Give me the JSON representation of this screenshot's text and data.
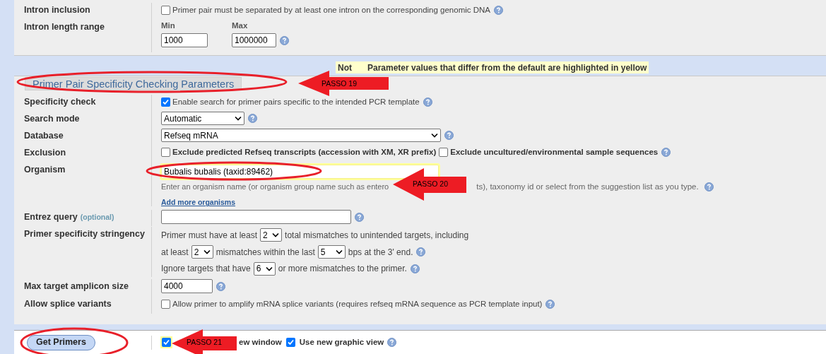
{
  "intron_section": {
    "rows": [
      {
        "kind": "checkbox",
        "label": "Intron inclusion",
        "checked": false,
        "text": "Primer pair must be separated by at least one intron on the corresponding genomic DNA",
        "help": true
      },
      {
        "kind": "range",
        "label": "Intron length range",
        "min_label": "Min",
        "min_value": "1000",
        "max_label": "Max",
        "max_value": "1000000",
        "help": true
      }
    ]
  },
  "note": {
    "visible_start": "Not",
    "visible_end": "Parameter values that differ from the default are highlighted in yellow"
  },
  "specificity_section": {
    "title": "Primer Pair Specificity Checking Parameters",
    "rows": [
      {
        "kind": "checkbox",
        "label": "Specificity check",
        "checked": true,
        "text": "Enable search for primer pairs specific to the intended PCR template",
        "help": true
      },
      {
        "kind": "short_select",
        "label": "Search mode",
        "value": "Automatic",
        "help": true
      },
      {
        "kind": "long_select",
        "label": "Database",
        "value": "Refseq mRNA",
        "help": true
      },
      {
        "kind": "checkboxes",
        "label": "Exclusion",
        "options": [
          {
            "text": "Exclude predicted Refseq transcripts (accession with XM, XR prefix)",
            "checked": false
          },
          {
            "text": "Exclude uncultured/environmental sample sequences",
            "checked": false
          }
        ],
        "help": true
      },
      {
        "kind": "organism",
        "label": "Organism",
        "value": "Bubalis bubalis (taxid:89462)",
        "highlighted": true,
        "hint_start": "Enter an organism name (or organism group name such as entero",
        "hint_end": "ts), taxonomy id or select from the suggestion list as you type.",
        "link": "Add more organisms",
        "help": true
      },
      {
        "kind": "long_input",
        "label": "Entrez query",
        "label_note": "(optional)",
        "value": "",
        "help": true
      },
      {
        "kind": "stringency",
        "label": "Primer specificity stringency",
        "lines": [
          {
            "help": false,
            "parts": [
              {
                "kind": "text",
                "text": "Primer must have at least"
              },
              {
                "kind": "select",
                "value": "2"
              },
              {
                "kind": "text",
                "text": "total mismatches to unintended targets, including"
              }
            ]
          },
          {
            "help": true,
            "parts": [
              {
                "kind": "text",
                "text": "at least"
              },
              {
                "kind": "select",
                "value": "2"
              },
              {
                "kind": "text",
                "text": "mismatches within the last"
              },
              {
                "kind": "wide_select",
                "value": "5"
              },
              {
                "kind": "text",
                "text": "bps at the 3' end."
              }
            ]
          },
          {
            "help": true,
            "parts": [
              {
                "kind": "text",
                "text": "Ignore targets that have"
              },
              {
                "kind": "select",
                "value": "6"
              },
              {
                "kind": "text",
                "text": "or more mismatches to the primer."
              }
            ]
          }
        ]
      },
      {
        "kind": "short_input",
        "label": "Max target amplicon size",
        "value": "4000",
        "help": true
      },
      {
        "kind": "checkbox",
        "label": "Allow splice variants",
        "checked": false,
        "text": "Allow primer to amplify mRNA splice variants (requires refseq mRNA sequence as PCR template input)",
        "help": true
      }
    ]
  },
  "submit": {
    "button": "Get Primers",
    "options": [
      {
        "text_end": "ew window",
        "checked": true,
        "highlighted": true
      },
      {
        "text": "Use new graphic view",
        "checked": true,
        "highlighted": false,
        "help": true
      }
    ]
  },
  "callouts": [
    {
      "label": "PASSO 19"
    },
    {
      "label": "PASSO 20"
    },
    {
      "label": "PASSO 21"
    }
  ]
}
